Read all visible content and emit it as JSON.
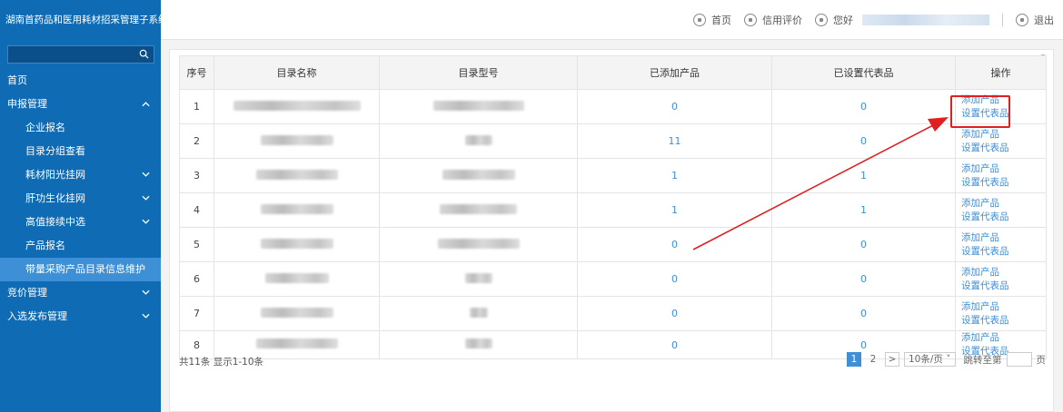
{
  "app": {
    "title": "湖南首药品和医用耗材招采管理子系统"
  },
  "sidebar": {
    "search_placeholder": "",
    "items": [
      {
        "label": "首页",
        "level": 1,
        "chevron": "none"
      },
      {
        "label": "申报管理",
        "level": 1,
        "chevron": "up"
      },
      {
        "label": "企业报名",
        "level": 2,
        "chevron": "none"
      },
      {
        "label": "目录分组查看",
        "level": 2,
        "chevron": "none"
      },
      {
        "label": "耗材阳光挂网",
        "level": 2,
        "chevron": "down"
      },
      {
        "label": "肝功生化挂网",
        "level": 2,
        "chevron": "down"
      },
      {
        "label": "高值接续中选",
        "level": 2,
        "chevron": "down"
      },
      {
        "label": "产品报名",
        "level": 2,
        "chevron": "none"
      },
      {
        "label": "带量采购产品目录信息维护",
        "level": 2,
        "chevron": "none",
        "active": true
      },
      {
        "label": "竞价管理",
        "level": 1,
        "chevron": "down"
      },
      {
        "label": "入选发布管理",
        "level": 1,
        "chevron": "down"
      }
    ]
  },
  "topbar": {
    "home": "首页",
    "credit": "信用评价",
    "greeting": "您好",
    "logout": "退出"
  },
  "table": {
    "columns": [
      "序号",
      "目录名称",
      "目录型号",
      "已添加产品",
      "已设置代表品",
      "操作"
    ],
    "rows": [
      {
        "index": "1",
        "added": "0",
        "representative": "0"
      },
      {
        "index": "2",
        "added": "11",
        "representative": "0"
      },
      {
        "index": "3",
        "added": "1",
        "representative": "1"
      },
      {
        "index": "4",
        "added": "1",
        "representative": "1"
      },
      {
        "index": "5",
        "added": "0",
        "representative": "0"
      },
      {
        "index": "6",
        "added": "0",
        "representative": "0"
      },
      {
        "index": "7",
        "added": "0",
        "representative": "0"
      },
      {
        "index": "8",
        "added": "0",
        "representative": "0"
      }
    ],
    "action_add": "添加产品",
    "action_set": "设置代表品"
  },
  "pagination": {
    "summary": "共11条 显示1-10条",
    "pages": [
      "1",
      "2"
    ],
    "next": ">",
    "page_size": "10条/页",
    "goto_label": "跳转至第",
    "page_unit": "页"
  },
  "colors": {
    "sidebar": "#0f6bb4",
    "active": "#3d8fd6",
    "link": "#3d8fd6",
    "annotation": "#e02020"
  }
}
